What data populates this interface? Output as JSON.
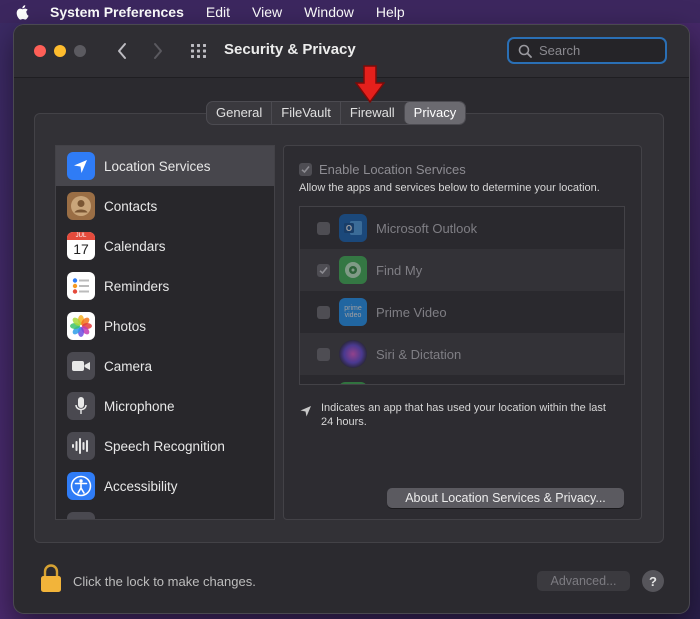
{
  "menubar": {
    "app_name": "System Preferences",
    "items": [
      "Edit",
      "View",
      "Window",
      "Help"
    ]
  },
  "window": {
    "title": "Security & Privacy",
    "search_placeholder": "Search",
    "tabs": [
      {
        "label": "General",
        "active": false
      },
      {
        "label": "FileVault",
        "active": false
      },
      {
        "label": "Firewall",
        "active": false
      },
      {
        "label": "Privacy",
        "active": true
      }
    ]
  },
  "sidebar": {
    "items": [
      {
        "label": "Location Services",
        "icon": "location-arrow-icon",
        "selected": true
      },
      {
        "label": "Contacts",
        "icon": "contacts-icon"
      },
      {
        "label": "Calendars",
        "icon": "calendar-icon",
        "month": "JUL",
        "day": "17"
      },
      {
        "label": "Reminders",
        "icon": "reminders-icon"
      },
      {
        "label": "Photos",
        "icon": "photos-icon"
      },
      {
        "label": "Camera",
        "icon": "camera-icon"
      },
      {
        "label": "Microphone",
        "icon": "microphone-icon"
      },
      {
        "label": "Speech Recognition",
        "icon": "waveform-icon"
      },
      {
        "label": "Accessibility",
        "icon": "accessibility-icon"
      }
    ]
  },
  "location": {
    "enable_label": "Enable Location Services",
    "enable_checked": true,
    "description": "Allow the apps and services below to determine your location.",
    "apps": [
      {
        "name": "Microsoft Outlook",
        "checked": false,
        "icon": "outlook-icon"
      },
      {
        "name": "Find My",
        "checked": true,
        "icon": "find-my-icon"
      },
      {
        "name": "Prime Video",
        "checked": false,
        "icon": "prime-video-icon",
        "icon_text": "prime video"
      },
      {
        "name": "Siri & Dictation",
        "checked": false,
        "icon": "siri-icon"
      }
    ],
    "note": "Indicates an app that has used your location within the last 24 hours.",
    "about_button": "About Location Services & Privacy..."
  },
  "footer": {
    "lock_text": "Click the lock to make changes.",
    "advanced_button": "Advanced...",
    "help_button": "?"
  }
}
